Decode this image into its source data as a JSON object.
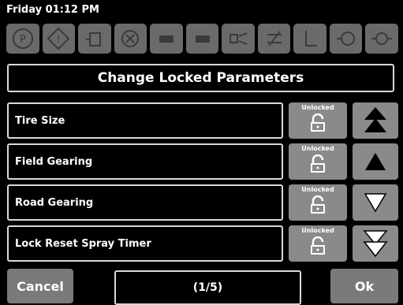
{
  "status": {
    "datetime": "Friday 01:12 PM"
  },
  "warning_icons": [
    "parking-brake-icon",
    "warning-icon",
    "fluid-level-icon",
    "spray-tank-icon",
    "pump-icon",
    "pump-off-icon",
    "spray-nozzle-icon",
    "spray-off-icon",
    "tank-flow-icon",
    "engine-icon",
    "coolant-icon"
  ],
  "title": "Change Locked Parameters",
  "parameters": [
    {
      "label": "Tire Size",
      "lock_status": "Unlocked"
    },
    {
      "label": "Field Gearing",
      "lock_status": "Unlocked"
    },
    {
      "label": "Road Gearing",
      "lock_status": "Unlocked"
    },
    {
      "label": "Lock Reset Spray Timer",
      "lock_status": "Unlocked"
    }
  ],
  "nav": [
    "page-up-icon",
    "up-icon",
    "down-icon",
    "page-down-icon"
  ],
  "footer": {
    "cancel_label": "Cancel",
    "page": "(1/5)",
    "ok_label": "Ok"
  },
  "colors": {
    "button_gray": "#8a8a8a",
    "border": "#d9d9d9",
    "background": "#000000"
  }
}
